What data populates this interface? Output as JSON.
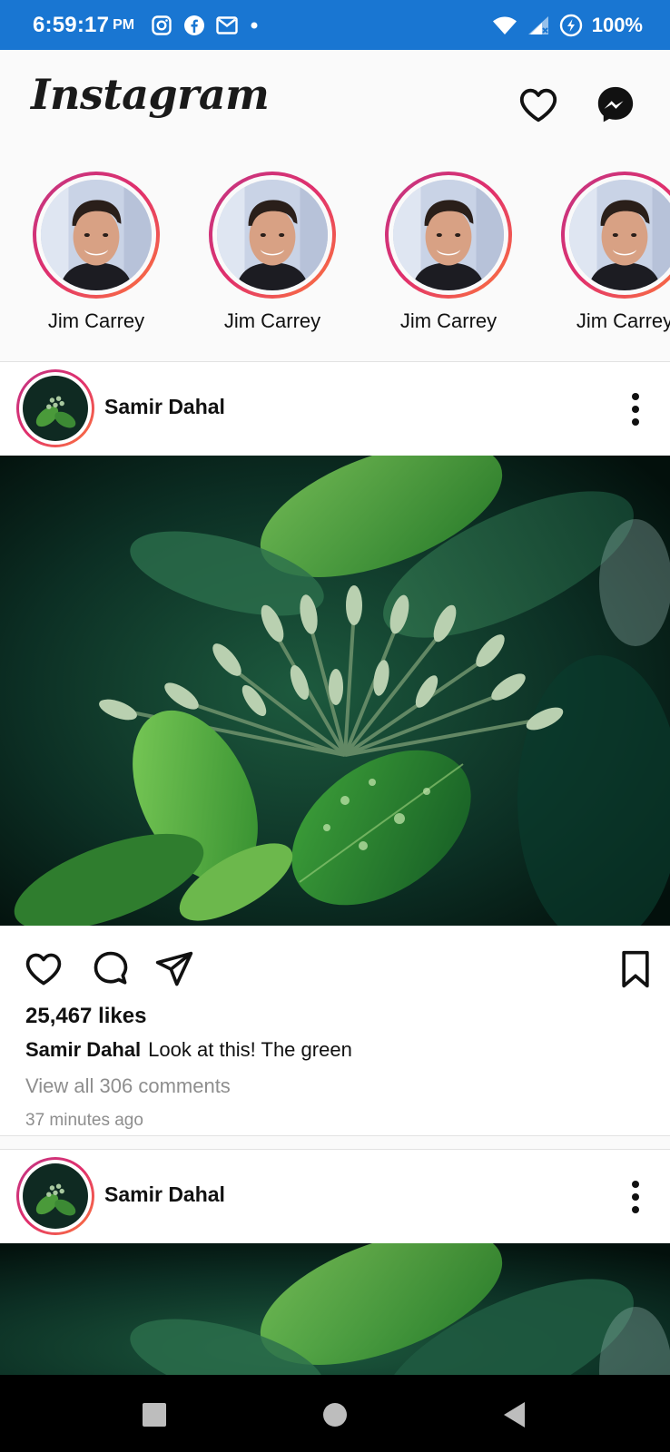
{
  "status_bar": {
    "time": "6:59:17",
    "ampm": "PM",
    "battery": "100%",
    "icons": [
      "instagram-icon",
      "facebook-icon",
      "gmail-icon",
      "dot-icon",
      "wifi-icon",
      "signal-icon",
      "battery-saver-icon"
    ]
  },
  "header": {
    "logo": "Instagram",
    "icons": [
      "heart-icon",
      "messenger-icon"
    ]
  },
  "stories": [
    {
      "name": "Jim Carrey"
    },
    {
      "name": "Jim Carrey"
    },
    {
      "name": "Jim Carrey"
    },
    {
      "name": "Jim Carrey"
    }
  ],
  "posts": [
    {
      "username": "Samir Dahal",
      "likes": "25,467 likes",
      "caption_user": "Samir Dahal",
      "caption_text": "Look at this! The green",
      "view_comments": "View all 306 comments",
      "time_ago": "37 minutes ago"
    },
    {
      "username": "Samir Dahal"
    }
  ],
  "colors": {
    "status_bar": "#1976d2",
    "story_ring_start": "#c13584",
    "story_ring_end": "#fd7a3a",
    "muted_text": "#8e8e8e",
    "nav_bar": "#000000"
  },
  "nav": [
    "recents-square-icon",
    "home-circle-icon",
    "back-triangle-icon"
  ]
}
